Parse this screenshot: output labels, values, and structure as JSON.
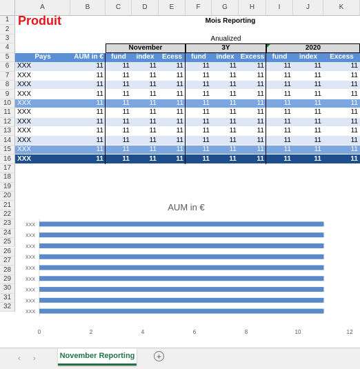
{
  "columns": [
    "A",
    "B",
    "C",
    "D",
    "E",
    "F",
    "G",
    "H",
    "I",
    "J",
    "K"
  ],
  "rows": [
    "1",
    "2",
    "3",
    "4",
    "5",
    "6",
    "7",
    "8",
    "9",
    "10",
    "11",
    "12",
    "13",
    "14",
    "15",
    "16",
    "17",
    "18",
    "19",
    "20",
    "21",
    "22",
    "23",
    "24",
    "25",
    "26",
    "27",
    "28",
    "29",
    "30",
    "31",
    "32"
  ],
  "title": "Produit",
  "report_label": "Mois Reporting",
  "annualized_label": "Anualized",
  "groups": [
    "November",
    "3Y",
    "2020"
  ],
  "headers": [
    "Pays",
    "AUM in €",
    "fund",
    "index",
    "Ecess",
    "fund",
    "index",
    "Excess",
    "fund",
    "index",
    "Excess"
  ],
  "table_rows": [
    {
      "pays": "XXX",
      "vals": [
        "11",
        "11",
        "11",
        "11",
        "11",
        "11",
        "11",
        "11",
        "11",
        "11"
      ]
    },
    {
      "pays": "XXX",
      "vals": [
        "11",
        "11",
        "11",
        "11",
        "11",
        "11",
        "11",
        "11",
        "11",
        "11"
      ]
    },
    {
      "pays": "XXX",
      "vals": [
        "11",
        "11",
        "11",
        "11",
        "11",
        "11",
        "11",
        "11",
        "11",
        "11"
      ]
    },
    {
      "pays": "XXX",
      "vals": [
        "11",
        "11",
        "11",
        "11",
        "11",
        "11",
        "11",
        "11",
        "11",
        "11"
      ]
    },
    {
      "pays": "XXX",
      "vals": [
        "11",
        "11",
        "11",
        "11",
        "11",
        "11",
        "11",
        "11",
        "11",
        "11"
      ]
    },
    {
      "pays": "XXX",
      "vals": [
        "11",
        "11",
        "11",
        "11",
        "11",
        "11",
        "11",
        "11",
        "11",
        "11"
      ]
    },
    {
      "pays": "XXX",
      "vals": [
        "11",
        "11",
        "11",
        "11",
        "11",
        "11",
        "11",
        "11",
        "11",
        "11"
      ]
    },
    {
      "pays": "XXX",
      "vals": [
        "11",
        "11",
        "11",
        "11",
        "11",
        "11",
        "11",
        "11",
        "11",
        "11"
      ]
    },
    {
      "pays": "XXX",
      "vals": [
        "11",
        "11",
        "11",
        "11",
        "11",
        "11",
        "11",
        "11",
        "11",
        "11"
      ]
    },
    {
      "pays": "XXX",
      "vals": [
        "11",
        "11",
        "11",
        "11",
        "11",
        "11",
        "11",
        "11",
        "11",
        "11"
      ]
    },
    {
      "pays": "XXX",
      "vals": [
        "11",
        "11",
        "11",
        "11",
        "11",
        "11",
        "11",
        "11",
        "11",
        "11"
      ]
    }
  ],
  "row_styles": [
    "light",
    "white",
    "light",
    "white",
    "blue",
    "white",
    "light",
    "white",
    "light",
    "blue",
    "dark"
  ],
  "colors": {
    "title_red": "#e8141b",
    "header_blue": "#5b8fd6",
    "row_light": "#dde7f5",
    "row_white": "#ffffff",
    "row_blue": "#7ba6e0",
    "row_dark": "#1f4e8c",
    "bar": "#5a89c8",
    "active_tab": "#217346"
  },
  "tabs": {
    "active": "November Reporting",
    "add_icon": "plus-circle-icon",
    "nav_left_icon": "chevron-left-icon",
    "nav_right_icon": "chevron-right-icon"
  },
  "chart_data": {
    "type": "bar",
    "orientation": "horizontal",
    "title": "AUM in €",
    "categories": [
      "XXX",
      "XXX",
      "XXX",
      "XXX",
      "XXX",
      "XXX",
      "XXX",
      "XXX",
      "XXX"
    ],
    "values": [
      11,
      11,
      11,
      11,
      11,
      11,
      11,
      11,
      11
    ],
    "xlim": [
      0,
      12
    ],
    "xticks": [
      "0",
      "2",
      "4",
      "6",
      "8",
      "10",
      "12"
    ],
    "grid": false,
    "legend": "none"
  }
}
